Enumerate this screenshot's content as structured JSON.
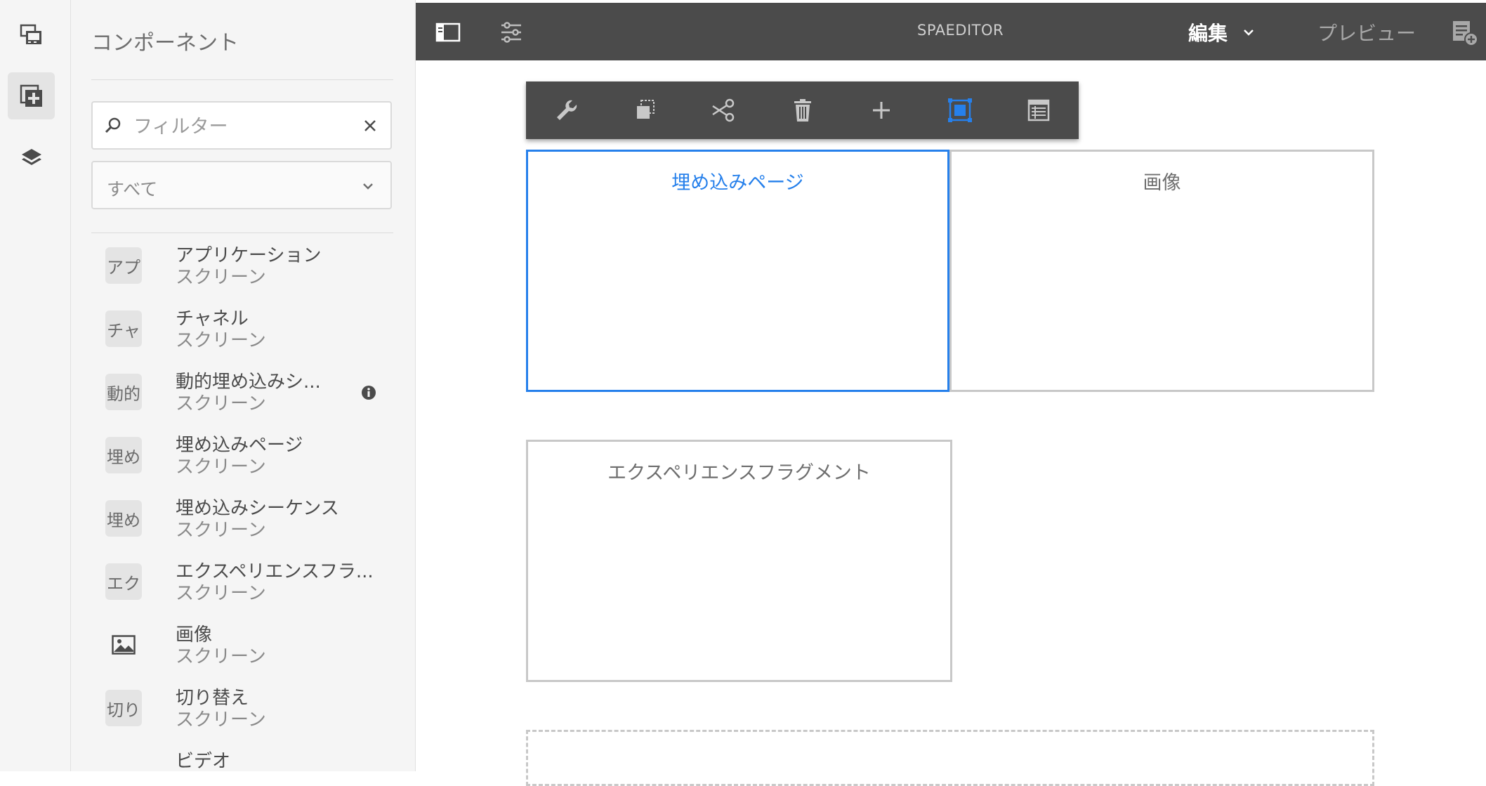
{
  "rail": {
    "buttons": [
      {
        "name": "assets",
        "icon": "assets-icon",
        "active": false
      },
      {
        "name": "components",
        "icon": "components-add-icon",
        "active": true
      },
      {
        "name": "content-tree",
        "icon": "layers-icon",
        "active": false
      }
    ]
  },
  "panel": {
    "title": "コンポーネント",
    "filter_placeholder": "フィルター",
    "group_select_value": "すべて",
    "items": [
      {
        "badge": "アプ",
        "name": "アプリケーション",
        "group": "スクリーン",
        "icon": null,
        "info": false
      },
      {
        "badge": "チャ",
        "name": "チャネル",
        "group": "スクリーン",
        "icon": null,
        "info": false
      },
      {
        "badge": "動的",
        "name": "動的埋め込みシ...",
        "group": "スクリーン",
        "icon": null,
        "info": true
      },
      {
        "badge": "埋め",
        "name": "埋め込みページ",
        "group": "スクリーン",
        "icon": null,
        "info": false
      },
      {
        "badge": "埋め",
        "name": "埋め込みシーケンス",
        "group": "スクリーン",
        "icon": null,
        "info": false
      },
      {
        "badge": "エク",
        "name": "エクスペリエンスフラ...",
        "group": "スクリーン",
        "icon": null,
        "info": false
      },
      {
        "badge": "",
        "name": "画像",
        "group": "スクリーン",
        "icon": "image-icon",
        "info": false
      },
      {
        "badge": "切り",
        "name": "切り替え",
        "group": "スクリーン",
        "icon": null,
        "info": false
      },
      {
        "badge": "",
        "name": "ビデオ",
        "group": "",
        "icon": "video-icon",
        "info": false
      }
    ]
  },
  "topbar": {
    "title": "SPAEDITOR",
    "mode_label": "編集",
    "preview_label": "プレビュー"
  },
  "component_toolbar": {
    "actions": [
      "configure",
      "copy",
      "cut",
      "delete",
      "insert",
      "parent",
      "layout"
    ]
  },
  "canvas": {
    "components": [
      {
        "label": "埋め込みページ",
        "selected": true
      },
      {
        "label": "画像",
        "selected": false
      },
      {
        "label": "エクスペリエンスフラグメント",
        "selected": false
      }
    ]
  },
  "colors": {
    "accent": "#2680eb",
    "topbar_bg": "#4b4b4b",
    "panel_bg": "#f5f5f5"
  }
}
